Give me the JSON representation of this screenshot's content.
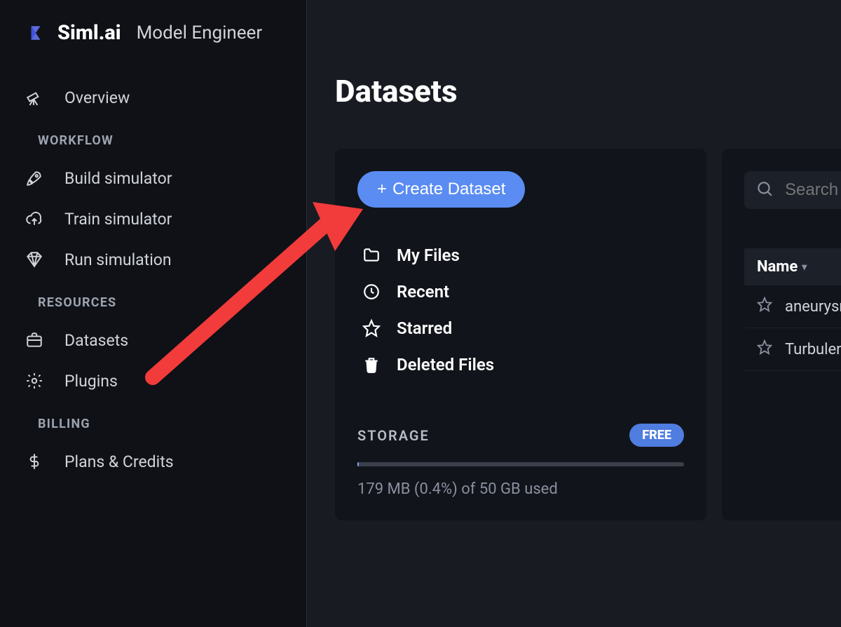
{
  "brand": {
    "name": "Siml.ai",
    "subtitle": "Model Engineer"
  },
  "sidebar": {
    "overview": "Overview",
    "sections": {
      "workflow": "WORKFLOW",
      "resources": "RESOURCES",
      "billing": "BILLING"
    },
    "items": {
      "build": "Build simulator",
      "train": "Train simulator",
      "run": "Run simulation",
      "datasets": "Datasets",
      "plugins": "Plugins",
      "plans": "Plans & Credits"
    }
  },
  "page": {
    "title": "Datasets"
  },
  "actions": {
    "create_dataset": "Create Dataset"
  },
  "filters": {
    "my_files": "My Files",
    "recent": "Recent",
    "starred": "Starred",
    "deleted": "Deleted Files"
  },
  "storage": {
    "label": "STORAGE",
    "badge": "FREE",
    "percent": 0.4,
    "text": "179 MB (0.4%) of 50 GB used"
  },
  "search": {
    "placeholder": "Search"
  },
  "table": {
    "column_name": "Name",
    "rows": [
      {
        "name": "aneurysm"
      },
      {
        "name": "Turbulence"
      }
    ]
  }
}
